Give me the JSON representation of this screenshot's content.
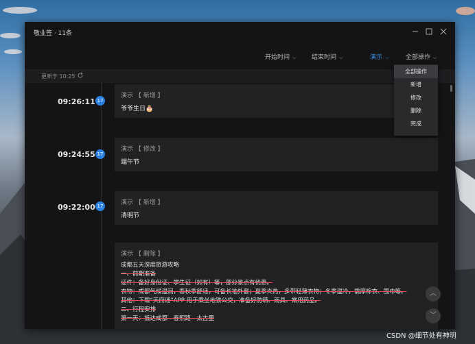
{
  "window": {
    "title": "敬业签 · 11条"
  },
  "filters": [
    {
      "label": "开始时间",
      "active": false
    },
    {
      "label": "结束时间",
      "active": false
    },
    {
      "label": "演示",
      "active": true
    },
    {
      "label": "全部操作",
      "active": false
    }
  ],
  "updated_text": "更新于 10:25",
  "dropdown": {
    "items": [
      "全部操作",
      "新增",
      "修改",
      "删除",
      "完成"
    ],
    "selected": "全部操作"
  },
  "entries": [
    {
      "time": "09:26:11",
      "badge": "17",
      "meta": "演示 【 新增 】",
      "title": "爷爷生日🎂"
    },
    {
      "time": "09:24:55",
      "badge": "17",
      "meta": "演示 【 修改 】",
      "title": "端午节"
    },
    {
      "time": "09:22:00",
      "badge": "17",
      "meta": "演示 【 新增 】",
      "title": "清明节"
    },
    {
      "meta": "演示 【 删除 】",
      "lines": [
        {
          "text": "成都五天深度旅游攻略",
          "strike": false
        },
        {
          "text": "一、前期准备",
          "strike": true
        },
        {
          "text": "证件：备好身份证、学生证（如有）等，部分景点有优惠。",
          "strike": true
        },
        {
          "text": "衣物：成都气候湿润，春秋季舒适，可备长袖外套；夏季炎热，多带轻薄衣物；冬季湿冷，需厚棉衣、围巾等。",
          "strike": true
        },
        {
          "text": "其他：下载“天府通”APP 用于乘坐地铁公交，准备好防晒、雨具、常用药品。",
          "strike": true
        },
        {
          "text": "二、行程安排",
          "strike": true
        },
        {
          "text": "第一天：抵达成都 - 春熙路 - 太古里",
          "strike": true
        }
      ]
    }
  ],
  "watermark": "CSDN @细节处有神明",
  "colors": {
    "accent": "#2a7fe0",
    "strike": "#e04b4b",
    "window_bg": "#141416",
    "card_bg": "#222224"
  }
}
